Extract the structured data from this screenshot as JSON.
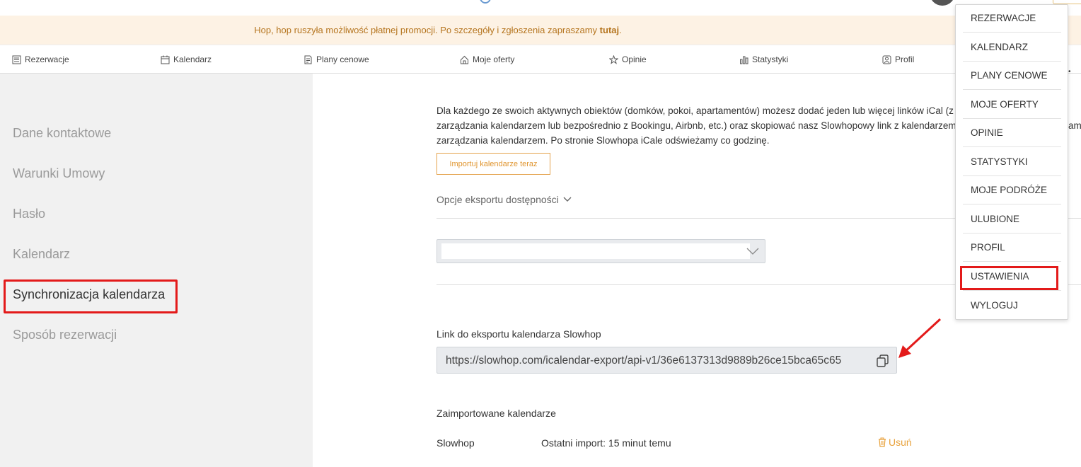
{
  "banner": {
    "text": "Hop, hop ruszyła możliwość płatnej promocji. Po szczegóły i zgłoszenia zapraszamy ",
    "link": "tutaj",
    "suffix": "."
  },
  "nav": {
    "items": [
      {
        "label": "Rezerwacje",
        "icon": "list-icon"
      },
      {
        "label": "Kalendarz",
        "icon": "calendar-icon"
      },
      {
        "label": "Plany cenowe",
        "icon": "document-icon"
      },
      {
        "label": "Moje oferty",
        "icon": "home-icon"
      },
      {
        "label": "Opinie",
        "icon": "star-icon"
      },
      {
        "label": "Statystyki",
        "icon": "bar-chart-icon"
      },
      {
        "label": "Profil",
        "icon": "user-icon"
      }
    ]
  },
  "sidebar": {
    "items": [
      {
        "label": "Dane kontaktowe"
      },
      {
        "label": "Warunki Umowy"
      },
      {
        "label": "Hasło"
      },
      {
        "label": "Kalendarz"
      },
      {
        "label": "Synchronizacja kalendarza",
        "active": true
      },
      {
        "label": "Sposób rezerwacji"
      }
    ]
  },
  "main": {
    "description_lines": [
      "Dla każdego ze swoich aktywnych obiektów (domków, pokoi, apartamentów) możesz dodać jeden lub więcej linków iCal (z",
      "zarządzania kalendarzem lub bezpośrednio z Bookingu, Airbnb, etc.) oraz skopiować nasz Slowhopowy link z kalendarzem",
      "zarządzania kalendarzem. Po stronie Slowhopa iCale odświeżamy co godzinę."
    ],
    "import_button": "Importuj kalendarze teraz",
    "export_options": "Opcje eksportu dostępności",
    "select_value": "",
    "link_label": "Link do eksportu kalendarza Slowhop",
    "link_value": "https://slowhop.com/icalendar-export/api-v1/36e6137313d9889b26ce15bca65c65",
    "imported_label": "Zaimportowane kalendarze",
    "calendars": [
      {
        "name": "Slowhop",
        "status": "Ostatni import: 15 minut temu",
        "remove": "Usuń"
      }
    ],
    "truncated_right": "amu"
  },
  "dropdown": {
    "items": [
      {
        "label": "REZERWACJE"
      },
      {
        "label": "KALENDARZ"
      },
      {
        "label": "PLANY CENOWE"
      },
      {
        "label": "MOJE OFERTY"
      },
      {
        "label": "OPINIE"
      },
      {
        "label": "STATYSTYKI"
      },
      {
        "label": "MOJE PODRÓŻE"
      },
      {
        "label": "ULUBIONE"
      },
      {
        "label": "PROFIL"
      },
      {
        "label": "USTAWIENIA",
        "highlighted": true
      },
      {
        "label": "WYLOGUJ"
      }
    ]
  },
  "colors": {
    "accent": "#e0952f",
    "highlight": "#e31a1a",
    "banner_bg": "#fdf2e4",
    "sidebar_bg": "#f1f1f1"
  }
}
